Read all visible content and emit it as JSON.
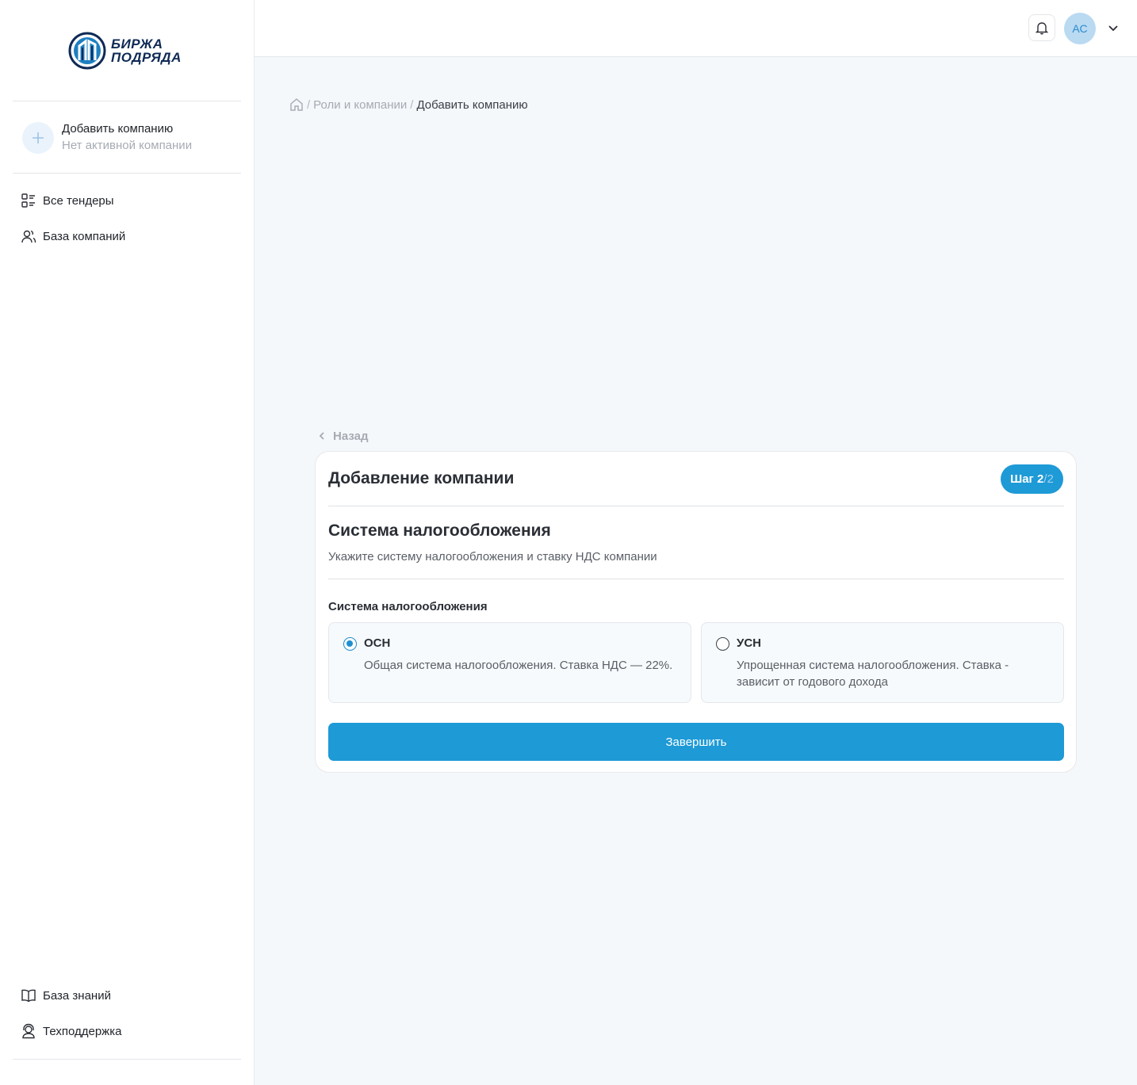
{
  "sidebar": {
    "logo": {
      "line1": "БИРЖА",
      "line2": "ПОДРЯДА"
    },
    "company": {
      "title": "Добавить компанию",
      "subtitle": "Нет активной компании",
      "icon": "plus-icon"
    },
    "nav": [
      {
        "label": "Все тендеры",
        "icon": "list-icon"
      },
      {
        "label": "База компаний",
        "icon": "users-icon"
      }
    ],
    "bottom_nav": [
      {
        "label": "База знаний",
        "icon": "book-icon"
      },
      {
        "label": "Техподдержка",
        "icon": "support-icon"
      }
    ]
  },
  "header": {
    "avatar_initials": "АС"
  },
  "breadcrumb": {
    "items": [
      "Роли и компании",
      "Добавить компанию"
    ],
    "separator": "/"
  },
  "back_label": "Назад",
  "card": {
    "title": "Добавление компании",
    "step": {
      "label": "Шаг 2",
      "total": "/2"
    },
    "section_title": "Система налогообложения",
    "section_desc": "Укажите систему налогообложения и ставку НДС компании",
    "field_label": "Система налогообложения",
    "options": [
      {
        "title": "ОСН",
        "desc": "Общая система налогообложения. Ставка НДС — 22%.",
        "selected": true
      },
      {
        "title": "УСН",
        "desc": "Упрощенная система налогообложения. Ставка - зависит от годового дохода",
        "selected": false
      }
    ],
    "submit_label": "Завершить"
  },
  "colors": {
    "accent": "#1e9ad6",
    "brand_dark": "#0f2a55",
    "avatar_bg": "#b9daf1",
    "page_bg": "#f5f8fb"
  }
}
